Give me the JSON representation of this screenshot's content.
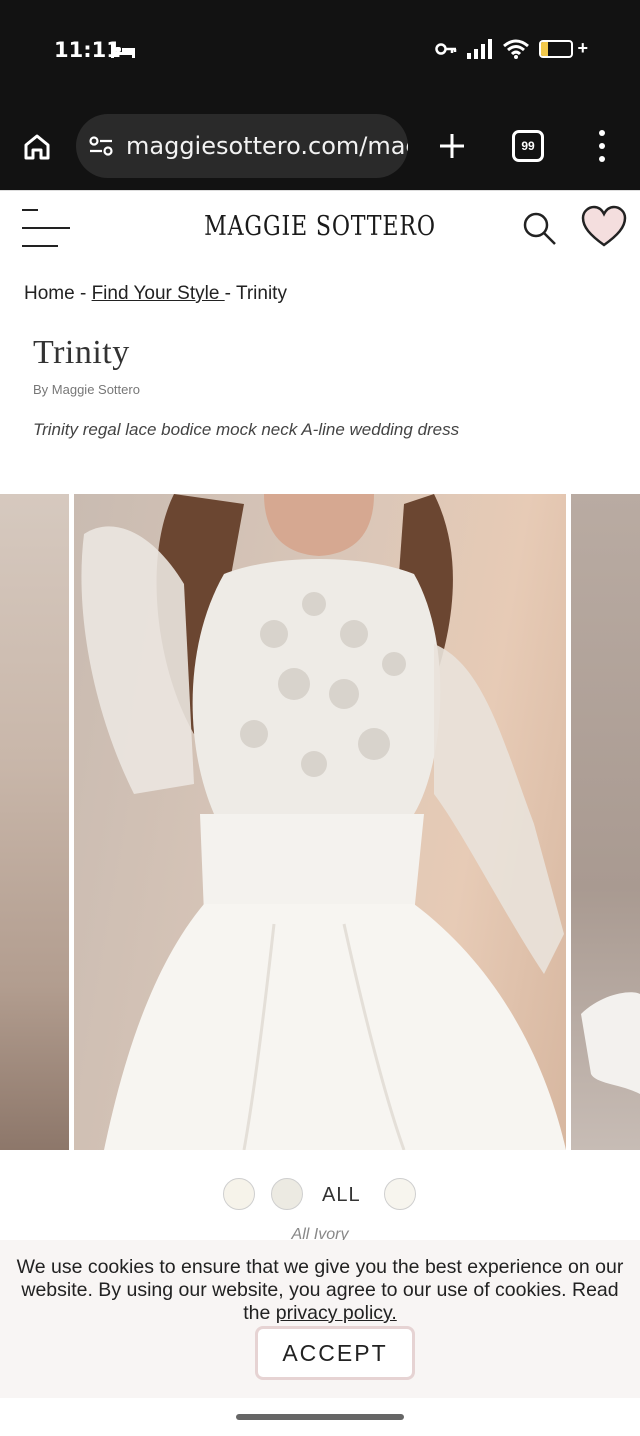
{
  "status_bar": {
    "time": "11:11",
    "battery_color": "#f2c94c",
    "icons": [
      "sleep-icon",
      "key-icon",
      "signal-icon",
      "wifi-icon",
      "battery-icon"
    ]
  },
  "browser": {
    "url": "maggiesottero.com/mag",
    "tab_count": "99",
    "icons": [
      "home-icon",
      "site-settings-icon",
      "new-tab-plus-icon",
      "tab-switcher-icon",
      "overflow-menu-icon"
    ]
  },
  "site": {
    "logo": "MAGGIE SOTTERO",
    "icons": [
      "hamburger-menu-icon",
      "search-icon",
      "wishlist-heart-icon"
    ],
    "heart_color": "#f4dede"
  },
  "breadcrumb": {
    "home": "Home",
    "sep1": " - ",
    "find": "Find Your Style ",
    "sep2": "- ",
    "current": "Trinity"
  },
  "product": {
    "title": "Trinity",
    "byline": "By Maggie Sottero",
    "description": "Trinity regal lace bodice mock neck A-line wedding dress",
    "gallery_icon": "favorite-heart-icon"
  },
  "color_selector": {
    "swatches": [
      "#f6f3ea",
      "#eceae2",
      "#f7f5ee"
    ],
    "all_label": "ALL",
    "selected_name": "All Ivory"
  },
  "cookie_banner": {
    "text": "We use cookies to ensure that we give you the best experience on our website. By using our website, you agree to our use of cookies. Read the ",
    "link": "privacy policy.",
    "accept": "ACCEPT"
  }
}
